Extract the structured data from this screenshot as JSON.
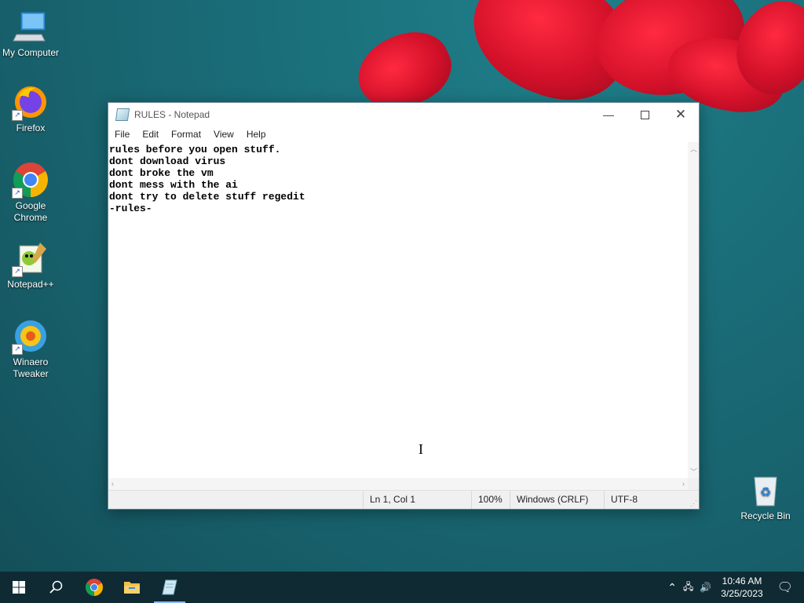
{
  "desktop": {
    "icons": [
      {
        "label": "My Computer"
      },
      {
        "label": "Firefox"
      },
      {
        "label": "Google Chrome"
      },
      {
        "label": "Notepad++"
      },
      {
        "label": "Winaero Tweaker"
      },
      {
        "label": "Recycle Bin"
      }
    ]
  },
  "window": {
    "title": "RULES - Notepad",
    "menu": [
      "File",
      "Edit",
      "Format",
      "View",
      "Help"
    ],
    "content": "rules before you open stuff.\ndont download virus\ndont broke the vm\ndont mess with the ai\ndont try to delete stuff regedit\n-rules-",
    "status": {
      "position": "Ln 1, Col 1",
      "zoom": "100%",
      "line_ending": "Windows (CRLF)",
      "encoding": "UTF-8"
    }
  },
  "taskbar": {
    "apps": [
      "start-icon",
      "search-icon",
      "chrome-icon",
      "file-explorer-icon",
      "notepad-icon"
    ],
    "time": "10:46 AM",
    "date": "3/25/2023"
  },
  "colors": {
    "accent": "#1a6f7a",
    "taskbar": "#0f2a33"
  }
}
